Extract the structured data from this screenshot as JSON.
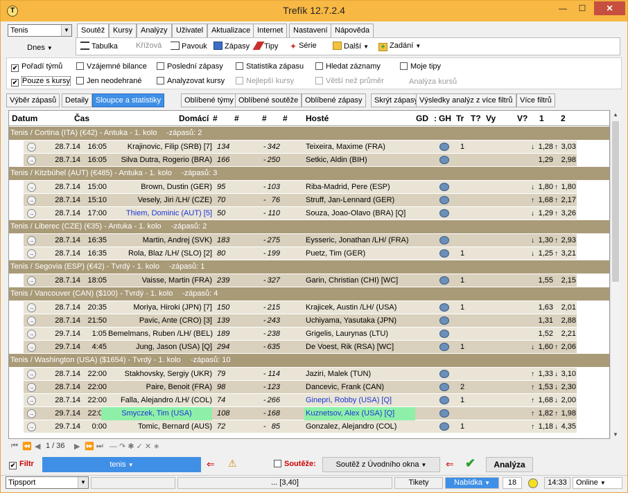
{
  "window": {
    "title": "Trefík 12.7.2.4",
    "min": "—",
    "max": "☐",
    "close": "✕"
  },
  "sport_select": {
    "value": "Tenis"
  },
  "date_button": {
    "label": "Dnes"
  },
  "menu_tabs": [
    "Soutěž",
    "Kursy",
    "Analýzy",
    "Uživatel",
    "Aktualizace",
    "Internet",
    "Nastavení",
    "Nápověda"
  ],
  "toolbar": {
    "tabulka": "Tabulka",
    "krizova": "Křížová",
    "pavouk": "Pavouk",
    "zapasy": "Zápasy",
    "tipy": "Tipy",
    "serie": "Série",
    "dalsi": "Další",
    "zadani": "Zadání"
  },
  "checks": [
    {
      "label": "Pořadí týmů",
      "checked": true,
      "disabled": false
    },
    {
      "label": "Vzájemné bilance",
      "checked": false,
      "disabled": false
    },
    {
      "label": "Poslední zápasy",
      "checked": false,
      "disabled": false
    },
    {
      "label": "Statistika zápasu",
      "checked": false,
      "disabled": false
    },
    {
      "label": "Hledat záznamy",
      "checked": false,
      "disabled": false
    },
    {
      "label": "Moje tipy",
      "checked": false,
      "disabled": false
    },
    {
      "label": "Pouze s kursy",
      "checked": true,
      "disabled": false
    },
    {
      "label": "Jen neodehrané",
      "checked": false,
      "disabled": false
    },
    {
      "label": "Analyzovat kursy",
      "checked": false,
      "disabled": false
    },
    {
      "label": "Nejlepší kursy",
      "checked": false,
      "disabled": true
    },
    {
      "label": "Větší než průměr",
      "checked": false,
      "disabled": true
    }
  ],
  "analyza_kursu": "Analýza kursů",
  "sub_tabs": [
    "Výběr zápasů",
    "Detaily",
    "Sloupce a statistiky",
    "Oblíbené týmy",
    "Oblíbené soutěže",
    "Oblíbené zápasy",
    "Skrýt zápasy",
    "Výsledky analýz z více filtrů",
    "Více filtrů"
  ],
  "columns": {
    "datum": "Datum",
    "cas": "Čas",
    "domaci": "Domácí",
    "h1": "#",
    "h2": "#",
    "h3": "#",
    "h4": "#",
    "hoste": "Hosté",
    "gd": "GD",
    "colon": ":",
    "gh": "GH",
    "tr": "Tr",
    "tq": "T?",
    "vy": "Vy",
    "vq": "V?",
    "k1": "1",
    "k2": "2"
  },
  "groups": [
    {
      "name": "Tenis / Cortina (ITA)  (€42) - Antuka - 1. kolo",
      "count": "-zápasů: 2",
      "rows": [
        {
          "date": "28.7.14",
          "time": "16:05",
          "home": "Krajinovic, Filip (SRB) [7]",
          "r1": "134",
          "dash": "-",
          "r2": "342",
          "away": "Teixeira, Maxime (FRA)",
          "tr": "1",
          "a1": "↓",
          "k1": "1,28",
          "a2": "↑",
          "k2": "3,03"
        },
        {
          "date": "28.7.14",
          "time": "16:05",
          "home": "Silva Dutra, Rogerio (BRA)",
          "r1": "166",
          "dash": "-",
          "r2": "250",
          "away": "Setkic, Aldin (BIH)",
          "tr": "",
          "a1": "",
          "k1": "1,29",
          "a2": "",
          "k2": "2,98"
        }
      ]
    },
    {
      "name": "Tenis / Kitzbühel (AUT)  (€485) - Antuka - 1. kolo",
      "count": "-zápasů: 3",
      "rows": [
        {
          "date": "28.7.14",
          "time": "15:00",
          "home": "Brown, Dustin (GER)",
          "r1": "95",
          "dash": "-",
          "r2": "103",
          "away": "Riba-Madrid, Pere (ESP)",
          "tr": "",
          "a1": "↓",
          "k1": "1,80",
          "a2": "↑",
          "k2": "1,80"
        },
        {
          "date": "28.7.14",
          "time": "15:10",
          "home": "Vesely, Jiri /LH/ (CZE)",
          "r1": "70",
          "dash": "-",
          "r2": "76",
          "away": "Struff, Jan-Lennard (GER)",
          "tr": "",
          "a1": "↑",
          "k1": "1,68",
          "a2": "↑",
          "k2": "2,17"
        },
        {
          "date": "28.7.14",
          "time": "17:00",
          "home": "Thiem, Dominic (AUT) [5]",
          "homeBlue": true,
          "r1": "50",
          "dash": "-",
          "r2": "110",
          "away": "Souza, Joao-Olavo (BRA) [Q]",
          "tr": "",
          "a1": "↓",
          "k1": "1,29",
          "a2": "↑",
          "k2": "3,26"
        }
      ]
    },
    {
      "name": "Tenis / Liberec (CZE)  (€35) - Antuka - 1. kolo",
      "count": "-zápasů: 2",
      "rows": [
        {
          "date": "28.7.14",
          "time": "16:35",
          "home": "Martin, Andrej (SVK)",
          "r1": "183",
          "dash": "-",
          "r2": "275",
          "away": "Eysseric, Jonathan /LH/ (FRA)",
          "tr": "",
          "a1": "↓",
          "k1": "1,30",
          "a2": "↑",
          "k2": "2,93"
        },
        {
          "date": "28.7.14",
          "time": "16:35",
          "home": "Rola, Blaz /LH/ (SLO) [2]",
          "r1": "80",
          "dash": "-",
          "r2": "199",
          "away": "Puetz, Tim (GER)",
          "tr": "1",
          "a1": "↓",
          "k1": "1,25",
          "a2": "↑",
          "k2": "3,21"
        }
      ]
    },
    {
      "name": "Tenis / Segovia (ESP)  (€42) - Tvrdý - 1. kolo",
      "count": "-zápasů: 1",
      "rows": [
        {
          "date": "28.7.14",
          "time": "18:05",
          "home": "Vaisse, Martin (FRA)",
          "r1": "239",
          "dash": "-",
          "r2": "327",
          "away": "Garin, Christian (CHI) [WC]",
          "tr": "1",
          "a1": "",
          "k1": "1,55",
          "a2": "",
          "k2": "2,15"
        }
      ]
    },
    {
      "name": "Tenis / Vancouver (CAN)  ($100) - Tvrdý - 1. kolo",
      "count": "-zápasů: 4",
      "rows": [
        {
          "date": "28.7.14",
          "time": "20:35",
          "home": "Moriya, Hiroki (JPN) [7]",
          "r1": "150",
          "dash": "-",
          "r2": "215",
          "away": "Krajicek, Austin /LH/ (USA)",
          "tr": "1",
          "a1": "",
          "k1": "1,63",
          "a2": "",
          "k2": "2,01"
        },
        {
          "date": "28.7.14",
          "time": "21:50",
          "home": "Pavic, Ante (CRO) [3]",
          "r1": "139",
          "dash": "-",
          "r2": "243",
          "away": "Uchiyama, Yasutaka (JPN)",
          "tr": "",
          "a1": "",
          "k1": "1,31",
          "a2": "",
          "k2": "2,88"
        },
        {
          "date": "29.7.14",
          "time": "1:05",
          "home": "Bemelmans, Ruben /LH/ (BEL)",
          "r1": "189",
          "dash": "-",
          "r2": "238",
          "away": "Grigelis, Laurynas (LTU)",
          "tr": "",
          "a1": "",
          "k1": "1,52",
          "a2": "",
          "k2": "2,21"
        },
        {
          "date": "29.7.14",
          "time": "4:45",
          "home": "Jung, Jason (USA) [Q]",
          "r1": "294",
          "dash": "-",
          "r2": "635",
          "away": "De Voest, Rik (RSA) [WC]",
          "tr": "1",
          "a1": "↓",
          "k1": "1,60",
          "a2": "↑",
          "k2": "2,06"
        }
      ]
    },
    {
      "name": "Tenis / Washington (USA)  ($1654) - Tvrdý - 1. kolo",
      "count": "-zápasů: 10",
      "rows": [
        {
          "date": "28.7.14",
          "time": "22:00",
          "home": "Stakhovsky, Sergiy (UKR)",
          "r1": "79",
          "dash": "-",
          "r2": "114",
          "away": "Jaziri, Malek (TUN)",
          "tr": "",
          "a1": "↑",
          "k1": "1,33",
          "a2": "↓",
          "k2": "3,10"
        },
        {
          "date": "28.7.14",
          "time": "22:00",
          "home": "Paire, Benoit (FRA)",
          "r1": "98",
          "dash": "-",
          "r2": "123",
          "away": "Dancevic, Frank (CAN)",
          "tr": "2",
          "a1": "↑",
          "k1": "1,53",
          "a2": "↓",
          "k2": "2,30"
        },
        {
          "date": "28.7.14",
          "time": "22:00",
          "home": "Falla, Alejandro /LH/ (COL)",
          "r1": "74",
          "dash": "-",
          "r2": "266",
          "away": "Ginepri, Robby (USA) [Q]",
          "awayBlue": true,
          "tr": "1",
          "a1": "↑",
          "k1": "1,68",
          "a2": "↓",
          "k2": "2,00"
        },
        {
          "date": "29.7.14",
          "time": "22:00",
          "home": "Smyczek, Tim (USA)",
          "homeBlue": true,
          "homeHl": true,
          "r1": "108",
          "dash": "-",
          "r2": "168",
          "away": "Kuznetsov, Alex (USA) [Q]",
          "awayBlue": true,
          "awayHl": true,
          "tr": "",
          "a1": "↑",
          "k1": "1,82",
          "a2": "↑",
          "k2": "1,98"
        },
        {
          "date": "29.7.14",
          "time": "0:00",
          "home": "Tomic, Bernard (AUS)",
          "r1": "72",
          "dash": "-",
          "r2": "85",
          "away": "Gonzalez, Alejandro (COL)",
          "tr": "1",
          "a1": "↑",
          "k1": "1,18",
          "a2": "↓",
          "k2": "4,35"
        }
      ]
    }
  ],
  "pager": {
    "first": "⏮",
    "prev2": "⏪",
    "prev": "◀",
    "page": "1 / 36",
    "next": "▶",
    "next2": "⏩",
    "last": "⏭",
    "extra": "— ↷ ✱ ✓ ✕ ∗"
  },
  "filter": {
    "label": "Filtr",
    "value": "tenis",
    "soutez_label": "Soutěže:",
    "soutez_value": "Soutěž z Úvodního okna",
    "analyza": "Analýza"
  },
  "status": {
    "bookmaker": "Tipsport",
    "center": "... [3,40]",
    "tikety": "Tikety",
    "nabidka": "Nabídka",
    "count": "18",
    "time": "14:33",
    "online": "Online"
  }
}
